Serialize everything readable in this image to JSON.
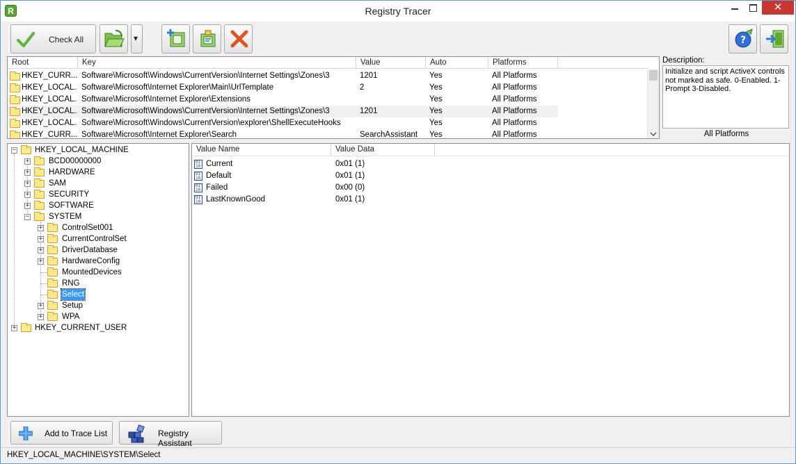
{
  "window": {
    "title": "Registry Tracer",
    "app_icon_letter": "R",
    "close_glyph": "✕"
  },
  "toolbar": {
    "check_all_label": "Check All",
    "dropdown_glyph": "▾"
  },
  "trace_list": {
    "columns": [
      "Root",
      "Key",
      "Value",
      "Auto",
      "Platforms"
    ],
    "rows": [
      {
        "root": "HKEY_CURR...",
        "key": "Software\\Microsoft\\Windows\\CurrentVersion\\Internet Settings\\Zones\\3",
        "value": "1201",
        "auto": "Yes",
        "platforms": "All Platforms"
      },
      {
        "root": "HKEY_LOCAL...",
        "key": "Software\\Microsoft\\Internet Explorer\\Main\\UrlTemplate",
        "value": "2",
        "auto": "Yes",
        "platforms": "All Platforms"
      },
      {
        "root": "HKEY_LOCAL...",
        "key": "Software\\Microsoft\\Internet Explorer\\Extensions",
        "value": "",
        "auto": "Yes",
        "platforms": "All Platforms"
      },
      {
        "root": "HKEY_LOCAL...",
        "key": "Software\\Microsoft\\Windows\\CurrentVersion\\Internet Settings\\Zones\\3",
        "value": "1201",
        "auto": "Yes",
        "platforms": "All Platforms"
      },
      {
        "root": "HKEY_LOCAL...",
        "key": "Software\\Microsoft\\Windows\\CurrentVersion\\explorer\\ShellExecuteHooks",
        "value": "",
        "auto": "Yes",
        "platforms": "All Platforms"
      },
      {
        "root": "HKEY_CURR...",
        "key": "Software\\Microsoft\\Internet Explorer\\Search",
        "value": "SearchAssistant",
        "auto": "Yes",
        "platforms": "All Platforms"
      }
    ]
  },
  "description": {
    "label": "Description:",
    "text": "Initialize and script ActiveX controls not marked as safe.  0-Enabled. 1-Prompt 3-Disabled.",
    "platforms": "All Platforms"
  },
  "tree": {
    "hklm": "HKEY_LOCAL_MACHINE",
    "hklm_children": [
      "BCD00000000",
      "HARDWARE",
      "SAM",
      "SECURITY",
      "SOFTWARE",
      "SYSTEM"
    ],
    "system_children": [
      "ControlSet001",
      "CurrentControlSet",
      "DriverDatabase",
      "HardwareConfig",
      "MountedDevices",
      "RNG",
      "Select",
      "Setup",
      "WPA"
    ],
    "hkcu": "HKEY_CURRENT_USER",
    "selected": "Select"
  },
  "values": {
    "columns": [
      "Value Name",
      "Value Data"
    ],
    "rows": [
      {
        "name": "Current",
        "data": "0x01 (1)"
      },
      {
        "name": "Default",
        "data": "0x01 (1)"
      },
      {
        "name": "Failed",
        "data": "0x00 (0)"
      },
      {
        "name": "LastKnownGood",
        "data": "0x01 (1)"
      }
    ]
  },
  "bottom": {
    "add_trace_label": "Add to Trace List",
    "registry_assistant_label": "Registry Assistant"
  },
  "status": {
    "path": "HKEY_LOCAL_MACHINE\\SYSTEM\\Select"
  }
}
